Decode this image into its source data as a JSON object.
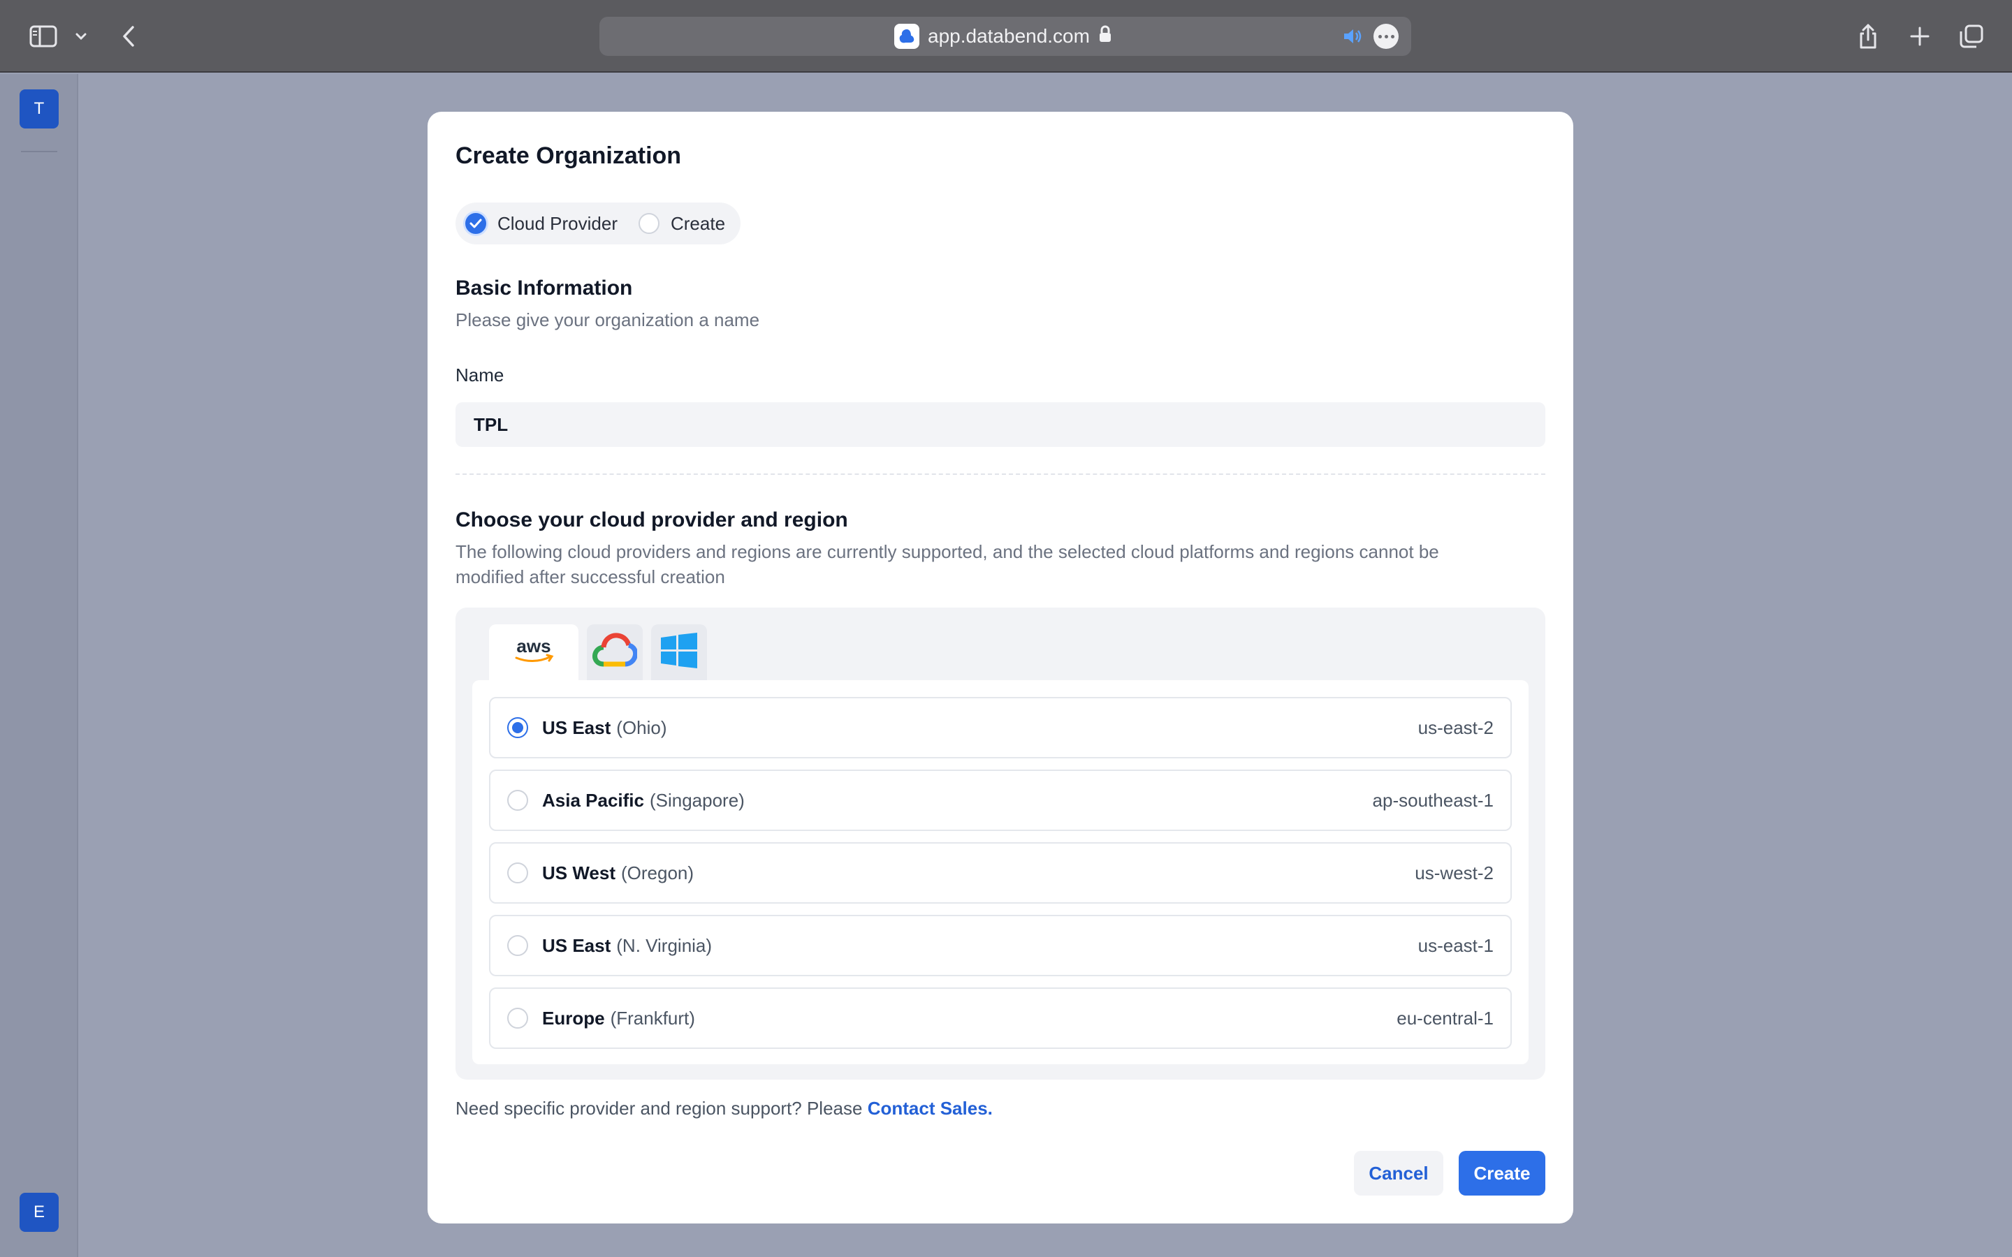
{
  "browser": {
    "url": "app.databend.com",
    "icons": [
      "sidebar-toggle-icon",
      "chevron-down-icon",
      "back-icon",
      "lock-icon",
      "speaker-icon",
      "more-icon",
      "share-icon",
      "new-tab-icon",
      "tabs-overview-icon"
    ]
  },
  "sidebar": {
    "top_avatar": "T",
    "bottom_avatar": "E"
  },
  "modal": {
    "title": "Create Organization",
    "steps": [
      {
        "label": "Cloud Provider",
        "state": "done"
      },
      {
        "label": "Create",
        "state": "pending"
      }
    ],
    "basic": {
      "heading": "Basic Information",
      "subtitle": "Please give your organization a name",
      "name_label": "Name",
      "name_value": "TPL"
    },
    "cloud": {
      "heading": "Choose your cloud provider and region",
      "description_line1": "The following cloud providers and regions are currently supported, and the selected cloud platforms and regions cannot be",
      "description_line2": "modified after successful creation",
      "providers": [
        {
          "name": "aws",
          "icon": "aws-logo-icon",
          "selected": true
        },
        {
          "name": "gcp",
          "icon": "google-cloud-icon",
          "selected": false
        },
        {
          "name": "azure",
          "icon": "windows-icon",
          "selected": false
        }
      ],
      "regions": [
        {
          "name": "US East",
          "location": "(Ohio)",
          "code": "us-east-2",
          "selected": true
        },
        {
          "name": "Asia Pacific",
          "location": "(Singapore)",
          "code": "ap-southeast-1",
          "selected": false
        },
        {
          "name": "US West",
          "location": "(Oregon)",
          "code": "us-west-2",
          "selected": false
        },
        {
          "name": "US East",
          "location": "(N. Virginia)",
          "code": "us-east-1",
          "selected": false
        },
        {
          "name": "Europe",
          "location": "(Frankfurt)",
          "code": "eu-central-1",
          "selected": false
        }
      ]
    },
    "footer": {
      "note": "Need specific provider and region support? Please",
      "link": "Contact Sales.",
      "cancel": "Cancel",
      "create": "Create"
    }
  },
  "colors": {
    "accent": "#2d6fe8",
    "link": "#2360d6",
    "overlay": "#9aa0b3"
  }
}
